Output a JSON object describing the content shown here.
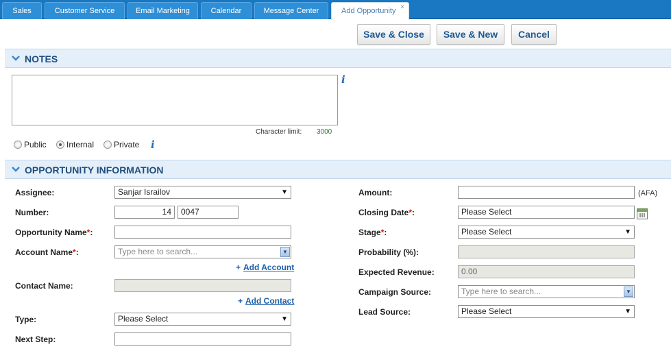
{
  "tabs": [
    {
      "label": "Sales"
    },
    {
      "label": "Customer Service"
    },
    {
      "label": "Email Marketing"
    },
    {
      "label": "Calendar"
    },
    {
      "label": "Message Center"
    },
    {
      "label": "Add Opportunity",
      "close": "×"
    }
  ],
  "toolbar": {
    "save_close": "Save & Close",
    "save_new": "Save & New",
    "cancel": "Cancel"
  },
  "notes": {
    "section_title": "NOTES",
    "text": "",
    "char_limit_label": "Character limit:",
    "char_limit_value": "3000",
    "visibility": [
      {
        "label": "Public",
        "checked": false
      },
      {
        "label": "Internal",
        "checked": true
      },
      {
        "label": "Private",
        "checked": false
      }
    ],
    "info": "i"
  },
  "opportunity": {
    "section_title": "OPPORTUNITY INFORMATION",
    "left": {
      "assignee_label": "Assignee:",
      "assignee_value": "Sanjar Israilov",
      "number_label": "Number:",
      "number_prefix": "14",
      "number_value": "0047",
      "opp_name_label": "Opportunity Name",
      "opp_name_value": "",
      "account_label": "Account Name",
      "account_placeholder": "Type here to search...",
      "add_account": "Add Account",
      "contact_label": "Contact Name:",
      "contact_value": "",
      "add_contact": "Add Contact",
      "type_label": "Type:",
      "type_value": "Please Select",
      "next_step_label": "Next Step:",
      "next_step_value": ""
    },
    "right": {
      "amount_label": "Amount:",
      "amount_value": "",
      "amount_unit": "(AFA)",
      "closing_label": "Closing Date",
      "closing_value": "Please Select",
      "stage_label": "Stage",
      "stage_value": "Please Select",
      "probability_label": "Probability (%):",
      "probability_value": "",
      "expected_label": "Expected Revenue:",
      "expected_value": "0.00",
      "campaign_label": "Campaign Source:",
      "campaign_placeholder": "Type here to search...",
      "lead_label": "Lead Source:",
      "lead_value": "Please Select"
    },
    "required_mark": "*",
    "plus": "+"
  },
  "colors": {
    "tabbar": "#1a78c2",
    "section_bg": "#e4eff9",
    "link": "#1e5fa8"
  }
}
